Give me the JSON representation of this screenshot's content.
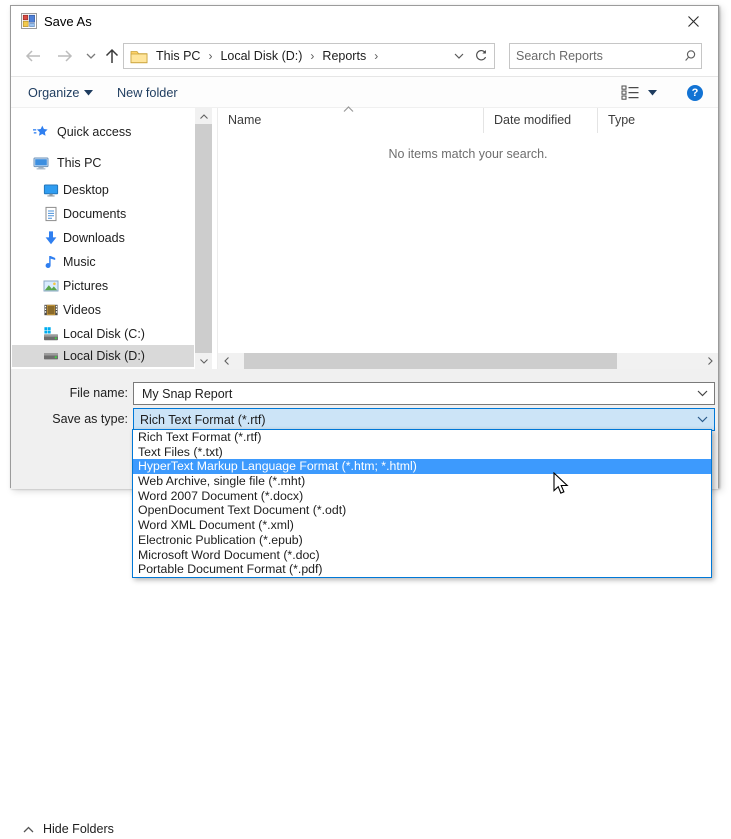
{
  "window": {
    "title": "Save As"
  },
  "nav": {
    "breadcrumb": [
      "This PC",
      "Local Disk (D:)",
      "Reports"
    ],
    "search_placeholder": "Search Reports"
  },
  "toolbar": {
    "organize": "Organize",
    "new_folder": "New folder"
  },
  "sidebar": {
    "items": [
      {
        "label": "Quick access",
        "icon": "quick-access",
        "level": 0,
        "selected": false
      },
      {
        "label": "This PC",
        "icon": "this-pc",
        "level": 0,
        "selected": false
      },
      {
        "label": "Desktop",
        "icon": "desktop",
        "level": 1,
        "selected": false
      },
      {
        "label": "Documents",
        "icon": "documents",
        "level": 1,
        "selected": false
      },
      {
        "label": "Downloads",
        "icon": "downloads",
        "level": 1,
        "selected": false
      },
      {
        "label": "Music",
        "icon": "music",
        "level": 1,
        "selected": false
      },
      {
        "label": "Pictures",
        "icon": "pictures",
        "level": 1,
        "selected": false
      },
      {
        "label": "Videos",
        "icon": "videos",
        "level": 1,
        "selected": false
      },
      {
        "label": "Local Disk (C:)",
        "icon": "drive-c",
        "level": 1,
        "selected": false
      },
      {
        "label": "Local Disk (D:)",
        "icon": "drive-d",
        "level": 1,
        "selected": true
      }
    ]
  },
  "file_list": {
    "columns": [
      "Name",
      "Date modified",
      "Type"
    ],
    "empty_message": "No items match your search."
  },
  "footer": {
    "file_name_label": "File name:",
    "file_name_value": "My Snap Report",
    "save_as_type_label": "Save as type:",
    "save_as_type_value": "Rich Text Format (*.rtf)",
    "hide_folders": "Hide Folders"
  },
  "type_dropdown": {
    "selected_index": 2,
    "items": [
      "Rich Text Format (*.rtf)",
      "Text Files (*.txt)",
      "HyperText Markup Language Format (*.htm; *.html)",
      "Web Archive, single file (*.mht)",
      "Word 2007 Document (*.docx)",
      "OpenDocument Text Document (*.odt)",
      "Word XML Document (*.xml)",
      "Electronic Publication (*.epub)",
      "Microsoft Word Document (*.doc)",
      "Portable Document Format (*.pdf)"
    ]
  },
  "colors": {
    "accent": "#0078d7",
    "selection_highlight": "#3d9afd",
    "combo_focus_bg": "#cce4f7",
    "help_button": "#1273d4"
  }
}
